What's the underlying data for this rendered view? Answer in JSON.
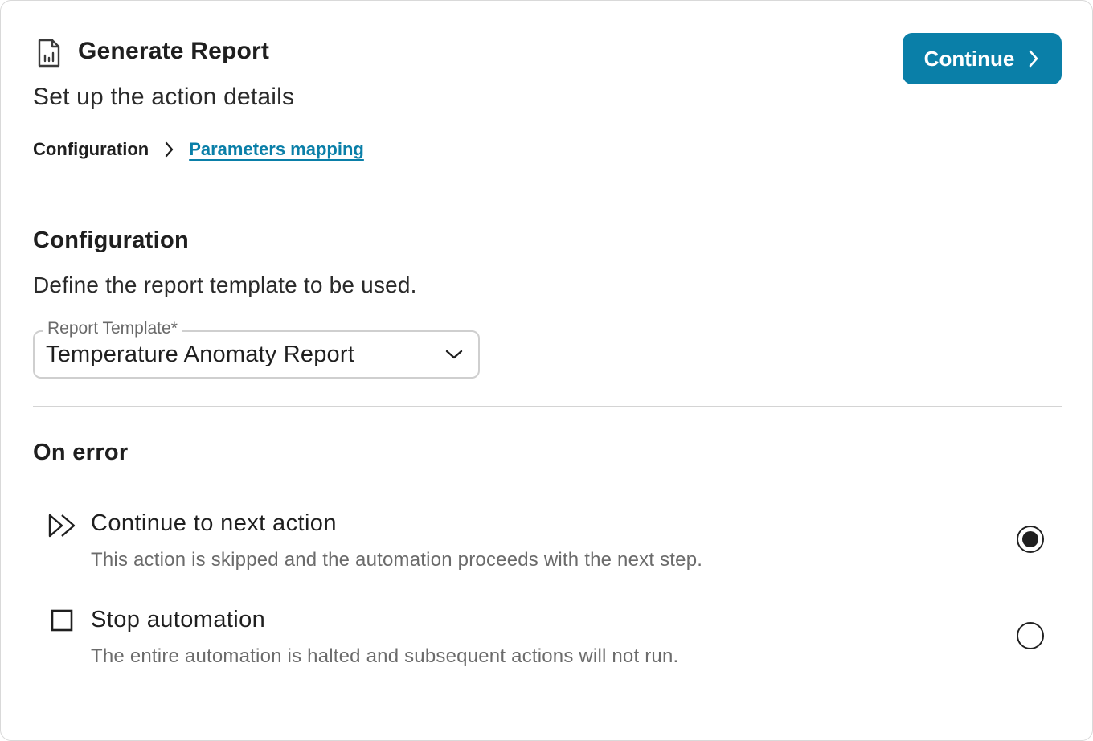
{
  "header": {
    "title": "Generate Report",
    "subtitle": "Set up the action details",
    "icon": "report-chart-icon",
    "continue_label": "Continue"
  },
  "breadcrumb": {
    "current": "Configuration",
    "next": "Parameters mapping"
  },
  "configuration": {
    "title": "Configuration",
    "description": "Define the report template to be used.",
    "template_select": {
      "label": "Report Template*",
      "value": "Temperature Anomaty Report"
    }
  },
  "on_error": {
    "title": "On error",
    "options": [
      {
        "icon": "fast-forward-icon",
        "title": "Continue to next action",
        "description": "This action is skipped and the automation proceeds with the next step.",
        "selected": true
      },
      {
        "icon": "stop-square-icon",
        "title": "Stop automation",
        "description": "The entire automation is halted and subsequent actions will not run.",
        "selected": false
      }
    ]
  },
  "colors": {
    "accent": "#0a7fa8",
    "divider": "#d4d4d4",
    "muted_text": "#6b6b6b"
  }
}
